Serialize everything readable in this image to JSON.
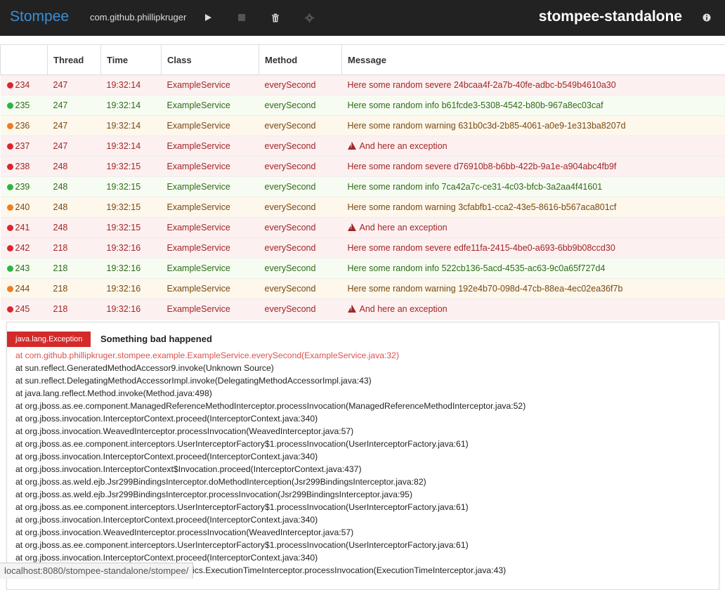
{
  "navbar": {
    "brand": "Stompee",
    "package": "com.github.phillipkruger",
    "app_title": "stompee-standalone",
    "icons": [
      "play-icon",
      "stop-icon",
      "trash-icon",
      "gear-icon",
      "info-icon"
    ]
  },
  "table": {
    "headers": [
      "",
      "Thread",
      "Time",
      "Class",
      "Method",
      "Message"
    ],
    "rows": [
      {
        "level": "severe",
        "id": "234",
        "thread": "247",
        "time": "19:32:14",
        "class": "ExampleService",
        "method": "everySecond",
        "message": "Here some random severe 24bcaa4f-2a7b-40fe-adbc-b549b4610a30",
        "exception": false
      },
      {
        "level": "info",
        "id": "235",
        "thread": "247",
        "time": "19:32:14",
        "class": "ExampleService",
        "method": "everySecond",
        "message": "Here some random info b61fcde3-5308-4542-b80b-967a8ec03caf",
        "exception": false
      },
      {
        "level": "warning",
        "id": "236",
        "thread": "247",
        "time": "19:32:14",
        "class": "ExampleService",
        "method": "everySecond",
        "message": "Here some random warning 631b0c3d-2b85-4061-a0e9-1e313ba8207d",
        "exception": false
      },
      {
        "level": "severe",
        "id": "237",
        "thread": "247",
        "time": "19:32:14",
        "class": "ExampleService",
        "method": "everySecond",
        "message": "And here an exception",
        "exception": true
      },
      {
        "level": "severe",
        "id": "238",
        "thread": "248",
        "time": "19:32:15",
        "class": "ExampleService",
        "method": "everySecond",
        "message": "Here some random severe d76910b8-b6bb-422b-9a1e-a904abc4fb9f",
        "exception": false
      },
      {
        "level": "info",
        "id": "239",
        "thread": "248",
        "time": "19:32:15",
        "class": "ExampleService",
        "method": "everySecond",
        "message": "Here some random info 7ca42a7c-ce31-4c03-bfcb-3a2aa4f41601",
        "exception": false
      },
      {
        "level": "warning",
        "id": "240",
        "thread": "248",
        "time": "19:32:15",
        "class": "ExampleService",
        "method": "everySecond",
        "message": "Here some random warning 3cfabfb1-cca2-43e5-8616-b567aca801cf",
        "exception": false
      },
      {
        "level": "severe",
        "id": "241",
        "thread": "248",
        "time": "19:32:15",
        "class": "ExampleService",
        "method": "everySecond",
        "message": "And here an exception",
        "exception": true
      },
      {
        "level": "severe",
        "id": "242",
        "thread": "218",
        "time": "19:32:16",
        "class": "ExampleService",
        "method": "everySecond",
        "message": "Here some random severe edfe11fa-2415-4be0-a693-6bb9b08ccd30",
        "exception": false
      },
      {
        "level": "info",
        "id": "243",
        "thread": "218",
        "time": "19:32:16",
        "class": "ExampleService",
        "method": "everySecond",
        "message": "Here some random info 522cb136-5acd-4535-ac63-9c0a65f727d4",
        "exception": false
      },
      {
        "level": "warning",
        "id": "244",
        "thread": "218",
        "time": "19:32:16",
        "class": "ExampleService",
        "method": "everySecond",
        "message": "Here some random warning 192e4b70-098d-47cb-88ea-4ec02ea36f7b",
        "exception": false
      },
      {
        "level": "severe",
        "id": "245",
        "thread": "218",
        "time": "19:32:16",
        "class": "ExampleService",
        "method": "everySecond",
        "message": "And here an exception",
        "exception": true
      }
    ]
  },
  "exception_panel": {
    "type": "java.lang.Exception",
    "message": "Something bad happened",
    "stacktrace": [
      "at com.github.phillipkruger.stompee.example.ExampleService.everySecond(ExampleService.java:32)",
      "at sun.reflect.GeneratedMethodAccessor9.invoke(Unknown Source)",
      "at sun.reflect.DelegatingMethodAccessorImpl.invoke(DelegatingMethodAccessorImpl.java:43)",
      "at java.lang.reflect.Method.invoke(Method.java:498)",
      "at org.jboss.as.ee.component.ManagedReferenceMethodInterceptor.processInvocation(ManagedReferenceMethodInterceptor.java:52)",
      "at org.jboss.invocation.InterceptorContext.proceed(InterceptorContext.java:340)",
      "at org.jboss.invocation.WeavedInterceptor.processInvocation(WeavedInterceptor.java:57)",
      "at org.jboss.as.ee.component.interceptors.UserInterceptorFactory$1.processInvocation(UserInterceptorFactory.java:61)",
      "at org.jboss.invocation.InterceptorContext.proceed(InterceptorContext.java:340)",
      "at org.jboss.invocation.InterceptorContext$Invocation.proceed(InterceptorContext.java:437)",
      "at org.jboss.as.weld.ejb.Jsr299BindingsInterceptor.doMethodInterception(Jsr299BindingsInterceptor.java:82)",
      "at org.jboss.as.weld.ejb.Jsr299BindingsInterceptor.processInvocation(Jsr299BindingsInterceptor.java:95)",
      "at org.jboss.as.ee.component.interceptors.UserInterceptorFactory$1.processInvocation(UserInterceptorFactory.java:61)",
      "at org.jboss.invocation.InterceptorContext.proceed(InterceptorContext.java:340)",
      "at org.jboss.invocation.WeavedInterceptor.processInvocation(WeavedInterceptor.java:57)",
      "at org.jboss.as.ee.component.interceptors.UserInterceptorFactory$1.processInvocation(UserInterceptorFactory.java:61)",
      "at org.jboss.invocation.InterceptorContext.proceed(InterceptorContext.java:340)",
      "at org.jboss.as.ejb3.component.invocationmetrics.ExecutionTimeInterceptor.processInvocation(ExecutionTimeInterceptor.java:43)"
    ]
  },
  "status_bar": {
    "url": "localhost:8080/stompee-standalone/stompee/"
  },
  "colors": {
    "navbar_bg": "#222222",
    "brand": "#3b8fd6",
    "severe": "#d9262b",
    "info": "#2bb544",
    "warning": "#f07d1a"
  }
}
